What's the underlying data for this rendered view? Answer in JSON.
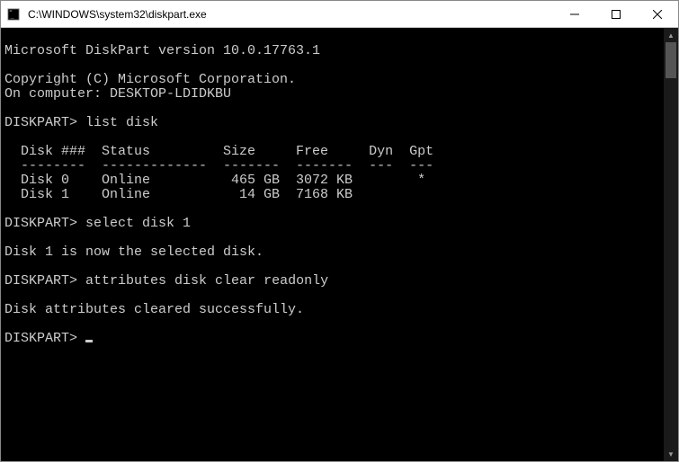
{
  "window": {
    "title": "C:\\WINDOWS\\system32\\diskpart.exe"
  },
  "terminal": {
    "line_blank": "",
    "version_line": "Microsoft DiskPart version 10.0.17763.1",
    "copyright_line": "Copyright (C) Microsoft Corporation.",
    "computer_line": "On computer: DESKTOP-LDIDKBU",
    "prompt": "DISKPART>",
    "cmd_list_disk": "list disk",
    "table_header": "  Disk ###  Status         Size     Free     Dyn  Gpt",
    "table_divider": "  --------  -------------  -------  -------  ---  ---",
    "disk_rows": [
      "  Disk 0    Online          465 GB  3072 KB        *",
      "  Disk 1    Online           14 GB  7168 KB"
    ],
    "cmd_select_disk": "select disk 1",
    "select_result": "Disk 1 is now the selected disk.",
    "cmd_attributes": "attributes disk clear readonly",
    "attributes_result": "Disk attributes cleared successfully."
  }
}
